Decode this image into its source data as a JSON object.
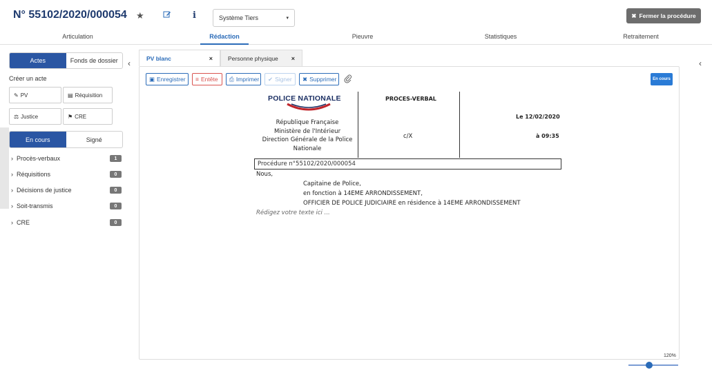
{
  "header": {
    "procedure_number": "N° 55102/2020/000054",
    "tiers_select": "Système Tiers",
    "close_button": "Fermer la procédure"
  },
  "top_tabs": [
    "Articulation",
    "Rédaction",
    "Pieuvre",
    "Statistiques",
    "Retraitement"
  ],
  "active_top_tab": "Rédaction",
  "left": {
    "tab_actes": "Actes",
    "tab_fonds": "Fonds de dossier",
    "creer_label": "Créer un acte",
    "actions": [
      "PV",
      "Réquisition",
      "Justice",
      "CRE"
    ],
    "status_on": "En cours",
    "status_off": "Signé",
    "categories": [
      {
        "label": "Procès-verbaux",
        "count": "1"
      },
      {
        "label": "Réquisitions",
        "count": "0"
      },
      {
        "label": "Décisions de justice",
        "count": "0"
      },
      {
        "label": "Soit-transmis",
        "count": "0"
      },
      {
        "label": "CRE",
        "count": "0"
      }
    ]
  },
  "doc_tabs": [
    {
      "label": "PV blanc",
      "close": "×"
    },
    {
      "label": "Personne physique",
      "close": "×"
    }
  ],
  "toolbar": {
    "save": "Enregistrer",
    "header": "Entête",
    "print": "Imprimer",
    "sign": "Signer",
    "delete": "Supprimer",
    "status": "En cours"
  },
  "document": {
    "logo": "POLICE NATIONALE",
    "header_title": "PROCES-VERBAL",
    "republique": "République Française",
    "ministere": "Ministère de l'Intérieur",
    "direction": "Direction Générale de la Police",
    "nationale": "Nationale",
    "cx": "c/X",
    "date": "Le 12/02/2020",
    "time": "à 09:35",
    "procedure": "Procédure n°55102/2020/000054",
    "nous": "Nous,",
    "line1": "Capitaine de Police,",
    "line2": "en fonction à 14EME ARRONDISSEMENT,",
    "line3": "OFFICIER DE POLICE JUDICIAIRE en résidence à 14EME ARRONDISSEMENT",
    "placeholder": "Rédigez votre texte ici ..."
  },
  "zoom": {
    "label": "120%",
    "value": 120
  }
}
